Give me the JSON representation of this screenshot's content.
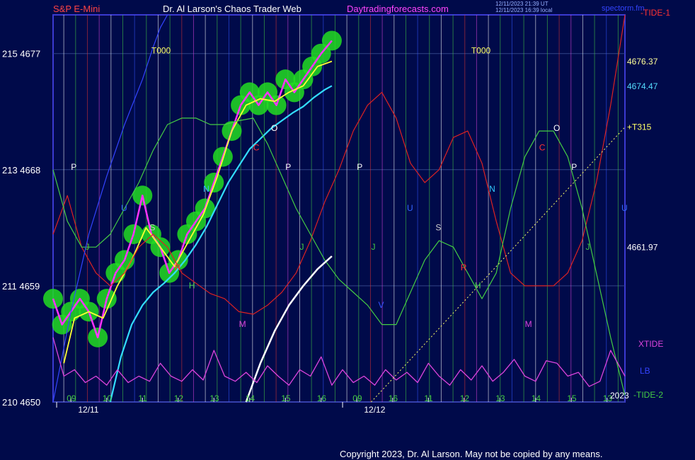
{
  "header": {
    "symbol": "S&P E-Mini",
    "site": "Dr. Al Larson's Chaos Trader Web",
    "link": "Daytradingforecasts.com",
    "timestamp_1": "12/11/2023 21:39 UT",
    "timestamp_2": "12/11/2023 16:39 local",
    "watermark": "spectorm.fm",
    "tide_top": "-TIDE-1"
  },
  "copyright": "Copyright 2023, Dr. Al Larson. May not be copied by any means.",
  "colors": {
    "background": "#000a4a",
    "frame": "#3a3ad0",
    "price": "#ff33ff",
    "fast_ma": "#ffff33",
    "slow_ma": "#33ddff",
    "halo": "#22dd22",
    "tide1": "#dd2222",
    "tide2": "#44cc44",
    "xtide": "#dd44dd",
    "lb": "#3344ff",
    "white_curve": "#ffffff"
  },
  "chart_data": {
    "type": "line",
    "title": "S&P E-Mini",
    "ylim": [
      4650,
      4680
    ],
    "y_ticks": [
      {
        "label": "215 4677",
        "value": 4677
      },
      {
        "label": "213 4668",
        "value": 4668
      },
      {
        "label": "211 4659",
        "value": 4659
      },
      {
        "label": "210 4650",
        "value": 4650
      }
    ],
    "hour_ticks": [
      {
        "label": "09",
        "t": 0.5
      },
      {
        "label": "10",
        "t": 1.5
      },
      {
        "label": "11",
        "t": 2.5
      },
      {
        "label": "12",
        "t": 3.5
      },
      {
        "label": "13",
        "t": 4.5
      },
      {
        "label": "14",
        "t": 5.5
      },
      {
        "label": "15",
        "t": 6.5
      },
      {
        "label": "16",
        "t": 7.5
      },
      {
        "label": "09",
        "t": 8.5
      },
      {
        "label": "16",
        "t": 9.5
      },
      {
        "label": "11",
        "t": 10.5
      },
      {
        "label": "12",
        "t": 11.5
      },
      {
        "label": "13",
        "t": 12.5
      },
      {
        "label": "14",
        "t": 13.5
      },
      {
        "label": "15",
        "t": 14.5
      },
      {
        "label": "13",
        "t": 15.5
      }
    ],
    "dates": [
      {
        "label": "12/11",
        "t": 0.7
      },
      {
        "label": "12/12",
        "t": 8.7
      }
    ],
    "right_levels": [
      {
        "label": "4676.37",
        "value": 4676.37,
        "color": "#ffff99"
      },
      {
        "label": "4674.47",
        "value": 4674.47,
        "color": "#55ddff"
      },
      {
        "label": "+T315",
        "value": 4671.3,
        "color": "#ffff66"
      },
      {
        "label": "4661.97",
        "value": 4661.97,
        "color": "#ffffff"
      }
    ],
    "right_labels": [
      {
        "label": "XTIDE",
        "color": "#dd44dd"
      },
      {
        "label": "LB",
        "color": "#3344ff"
      },
      {
        "label": "-TIDE-2",
        "color": "#44cc44"
      },
      {
        "label": "2023",
        "color": "#ffffff"
      }
    ],
    "markers": [
      {
        "label": "T000",
        "t": 2.75,
        "value": 4677,
        "color": "#ffff66"
      },
      {
        "label": "T000",
        "t": 11.7,
        "value": 4677,
        "color": "#ffff66"
      },
      {
        "label": "P",
        "t": 0.5,
        "value": 4668,
        "color": "#ffffff"
      },
      {
        "label": "P",
        "t": 6.5,
        "value": 4668,
        "color": "#ffffff"
      },
      {
        "label": "P",
        "t": 8.5,
        "value": 4668,
        "color": "#ffffff"
      },
      {
        "label": "P",
        "t": 14.5,
        "value": 4668,
        "color": "#ffffff"
      },
      {
        "label": "O",
        "t": 6.1,
        "value": 4671,
        "color": "#ffffff"
      },
      {
        "label": "O",
        "t": 14.0,
        "value": 4671,
        "color": "#ffffff"
      },
      {
        "label": "C",
        "t": 5.6,
        "value": 4669.5,
        "color": "#ff3333"
      },
      {
        "label": "C",
        "t": 13.6,
        "value": 4669.5,
        "color": "#ff3333"
      },
      {
        "label": "N",
        "t": 4.2,
        "value": 4666.3,
        "color": "#33ccff"
      },
      {
        "label": "N",
        "t": 12.2,
        "value": 4666.3,
        "color": "#33ccff"
      },
      {
        "label": "U",
        "t": 1.9,
        "value": 4664.8,
        "color": "#3366ff"
      },
      {
        "label": "U",
        "t": 9.9,
        "value": 4664.8,
        "color": "#3366ff"
      },
      {
        "label": "U",
        "t": 15.9,
        "value": 4664.8,
        "color": "#3366ff"
      },
      {
        "label": "S",
        "t": 2.7,
        "value": 4663.3,
        "color": "#cccccc"
      },
      {
        "label": "S",
        "t": 10.7,
        "value": 4663.3,
        "color": "#cccccc"
      },
      {
        "label": "J",
        "t": 0.9,
        "value": 4661.8,
        "color": "#44cc44"
      },
      {
        "label": "J",
        "t": 6.9,
        "value": 4661.8,
        "color": "#44cc44"
      },
      {
        "label": "J",
        "t": 8.9,
        "value": 4661.8,
        "color": "#44cc44"
      },
      {
        "label": "J",
        "t": 14.9,
        "value": 4661.8,
        "color": "#44cc44"
      },
      {
        "label": "R",
        "t": 3.4,
        "value": 4660.2,
        "color": "#ff3333"
      },
      {
        "label": "R",
        "t": 11.4,
        "value": 4660.2,
        "color": "#ff3333"
      },
      {
        "label": "H",
        "t": 3.8,
        "value": 4658.8,
        "color": "#44dd44"
      },
      {
        "label": "H",
        "t": 11.8,
        "value": 4658.8,
        "color": "#44dd44"
      },
      {
        "label": "V",
        "t": 9.1,
        "value": 4657.3,
        "color": "#3355ff"
      },
      {
        "label": "M",
        "t": 5.2,
        "value": 4655.8,
        "color": "#dd44dd"
      },
      {
        "label": "M",
        "t": 13.2,
        "value": 4655.8,
        "color": "#dd44dd"
      }
    ],
    "series": [
      {
        "name": "price",
        "x": [
          0,
          0.25,
          0.5,
          0.75,
          1,
          1.25,
          1.5,
          1.75,
          2,
          2.25,
          2.5,
          2.75,
          3,
          3.25,
          3.5,
          3.75,
          4,
          4.25,
          4.5,
          4.75,
          5,
          5.25,
          5.5,
          5.75,
          6,
          6.25,
          6.5,
          6.75,
          7,
          7.25,
          7.5,
          7.8
        ],
        "values": [
          4658,
          4656,
          4657,
          4658,
          4657,
          4655,
          4658,
          4660,
          4661,
          4663,
          4666,
          4663,
          4662,
          4660,
          4661,
          4663,
          4664,
          4665,
          4667,
          4669,
          4671,
          4673,
          4674,
          4673,
          4674,
          4673,
          4675,
          4674,
          4675,
          4676,
          4677,
          4678
        ]
      },
      {
        "name": "fast_ma",
        "x": [
          0.3,
          0.6,
          1,
          1.4,
          1.8,
          2.2,
          2.6,
          3,
          3.4,
          3.8,
          4.2,
          4.6,
          5,
          5.4,
          5.8,
          6.2,
          6.6,
          7,
          7.4,
          7.8
        ],
        "values": [
          4653,
          4656.5,
          4657,
          4656.5,
          4659,
          4661,
          4663.5,
          4662,
          4660.5,
          4662.5,
          4664.5,
          4667.5,
          4671,
          4673,
          4673.5,
          4673.3,
          4674,
          4674.5,
          4676,
          4676.4
        ]
      },
      {
        "name": "slow_ma",
        "x": [
          1.6,
          1.9,
          2.2,
          2.5,
          2.8,
          3.1,
          3.4,
          3.7,
          4,
          4.3,
          4.6,
          4.9,
          5.2,
          5.5,
          5.8,
          6.1,
          6.4,
          6.7,
          7,
          7.3,
          7.6,
          7.8
        ],
        "values": [
          4650,
          4653.5,
          4656,
          4657.5,
          4658.5,
          4659.2,
          4660,
          4661,
          4662.2,
          4663.6,
          4665.3,
          4667,
          4668.3,
          4669.6,
          4670.4,
          4671.2,
          4671.8,
          4672.4,
          4672.9,
          4673.6,
          4674.2,
          4674.5
        ]
      },
      {
        "name": "tide1",
        "x": [
          0,
          0.4,
          0.8,
          1.2,
          1.6,
          2,
          2.4,
          2.8,
          3.2,
          3.6,
          4,
          4.4,
          4.8,
          5.2,
          5.6,
          6,
          6.4,
          6.8,
          7.2,
          7.6,
          8,
          8.4,
          8.8,
          9.2,
          9.6,
          10,
          10.4,
          10.8,
          11.2,
          11.6,
          12,
          12.4,
          12.8,
          13.2,
          13.6,
          14,
          14.4,
          14.8,
          15.2,
          15.6,
          16
        ],
        "values": [
          4663,
          4666,
          4662,
          4660,
          4659,
          4660,
          4662,
          4663,
          4662,
          4660,
          4659.2,
          4658.4,
          4658,
          4657,
          4656.8,
          4657.5,
          4658.5,
          4660,
          4662.5,
          4665.5,
          4668,
          4671,
          4673,
          4674,
          4672,
          4668.5,
          4667,
          4668,
          4670.5,
          4671,
          4668.5,
          4664,
          4660,
          4659,
          4659,
          4659,
          4660,
          4662.5,
          4667,
          4673,
          4680
        ]
      },
      {
        "name": "tide2",
        "x": [
          0,
          0.4,
          0.8,
          1.2,
          1.6,
          2,
          2.4,
          2.8,
          3.2,
          3.6,
          4,
          4.4,
          4.8,
          5.2,
          5.6,
          6,
          6.4,
          6.8,
          7.2,
          7.6,
          8,
          8.4,
          8.8,
          9.2,
          9.6,
          10,
          10.4,
          10.8,
          11.2,
          11.6,
          12,
          12.4,
          12.8,
          13.2,
          13.6,
          14,
          14.4,
          14.8,
          15.2,
          15.6,
          16
        ],
        "values": [
          4668,
          4664,
          4662,
          4662,
          4663,
          4665,
          4667,
          4669.5,
          4671.5,
          4672,
          4672,
          4671.5,
          4671.5,
          4671.8,
          4672,
          4670,
          4667.5,
          4665,
          4663,
          4661,
          4659.5,
          4658.5,
          4657.5,
          4656,
          4656,
          4658.5,
          4661,
          4662.5,
          4662,
          4660,
          4658,
          4660,
          4665,
          4669,
          4671,
          4671,
          4669,
          4665,
          4660,
          4655,
          4650.5
        ]
      },
      {
        "name": "lb",
        "x": [
          0,
          0.5,
          1,
          1.5,
          2,
          2.5,
          2.8,
          3,
          3.2
        ],
        "values": [
          4650,
          4657,
          4663,
          4667.5,
          4671.5,
          4675,
          4677.5,
          4679,
          4680
        ]
      },
      {
        "name": "white_curve",
        "x": [
          5.4,
          5.8,
          6.2,
          6.6,
          7,
          7.4,
          7.8
        ],
        "values": [
          4650,
          4653,
          4655.5,
          4657.5,
          4659,
          4660.3,
          4661.3
        ]
      },
      {
        "name": "xtide",
        "x": [
          0,
          0.3,
          0.6,
          0.9,
          1.2,
          1.5,
          1.8,
          2.1,
          2.4,
          2.7,
          3,
          3.3,
          3.6,
          3.9,
          4.2,
          4.5,
          4.8,
          5.1,
          5.4,
          5.7,
          6,
          6.3,
          6.6,
          6.9,
          7.2,
          7.5,
          7.8,
          8.1,
          8.4,
          8.7,
          9,
          9.3,
          9.6,
          9.9,
          10.2,
          10.5,
          10.8,
          11.1,
          11.4,
          11.7,
          12,
          12.3,
          12.6,
          12.9,
          13.2,
          13.5,
          13.8,
          14.1,
          14.4,
          14.7,
          15,
          15.3,
          15.6,
          16
        ],
        "values": [
          4655,
          4652,
          4652.5,
          4651.5,
          4652,
          4651.3,
          4652.5,
          4651.5,
          4652,
          4651.6,
          4653,
          4652,
          4651.6,
          4652.5,
          4651.7,
          4654,
          4652,
          4651.6,
          4652.3,
          4651.5,
          4652.8,
          4652,
          4651.3,
          4652.5,
          4652,
          4653.5,
          4651.3,
          4652.5,
          4651.5,
          4652,
          4651.3,
          4652.5,
          4651.7,
          4652.3,
          4651.5,
          4653,
          4652,
          4651.3,
          4652.5,
          4651.7,
          4652.8,
          4651.6,
          4652.3,
          4653.3,
          4652,
          4651.6,
          4653.2,
          4653,
          4652,
          4652.3,
          4651.2,
          4651.6,
          4654,
          4652
        ]
      }
    ]
  }
}
